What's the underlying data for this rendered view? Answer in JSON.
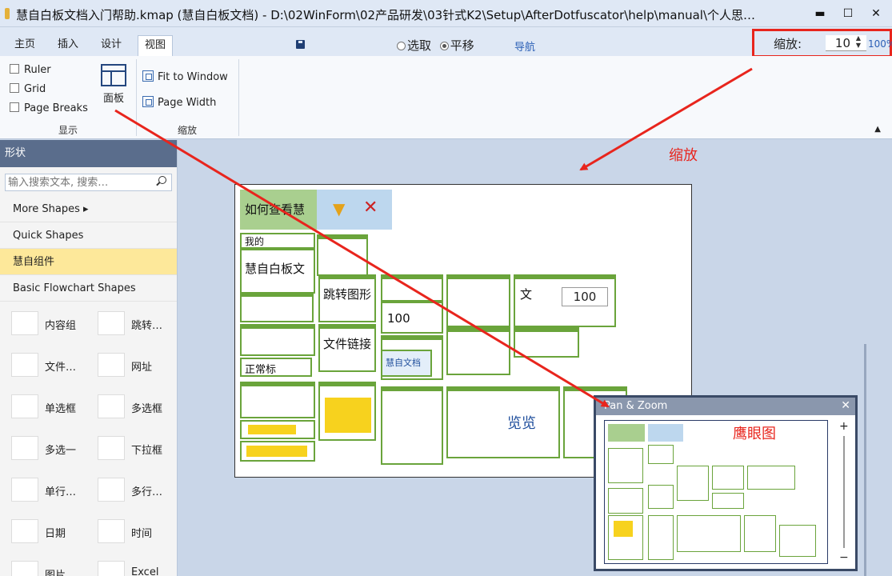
{
  "window": {
    "title": "慧自白板文档入门帮助.kmap (慧自白板文档) -  D:\\02WinForm\\02产品研发\\03针式K2\\Setup\\AfterDotfuscator\\help\\manual\\个人思…",
    "min": "▬",
    "max": "☐",
    "close": "✕"
  },
  "tabs": [
    "主页",
    "插入",
    "设计",
    "视图"
  ],
  "toolbar": {
    "mode_select": "选取",
    "mode_pan": "平移",
    "nav": "导航",
    "zoom_label": "缩放:",
    "zoom_value": "10",
    "zoom_percent": "100%"
  },
  "ribbon": {
    "show_group": {
      "label": "显示",
      "ruler": "Ruler",
      "grid": "Grid",
      "page_breaks": "Page Breaks",
      "panel": "面板"
    },
    "zoom_group": {
      "label": "缩放",
      "fit_window": "Fit to Window",
      "page_width": "Page Width"
    }
  },
  "side": {
    "title": "形状",
    "search_placeholder": "输入搜索文本, 搜索…",
    "categories": [
      "More Shapes ▸",
      "Quick Shapes",
      "慧自组件",
      "Basic Flowchart Shapes"
    ],
    "items": [
      "内容组",
      "跳转…",
      "文件…",
      "网址",
      "单选框",
      "多选框",
      "多选一",
      "下拉框",
      "单行…",
      "多行…",
      "日期",
      "时间",
      "图片",
      "Excel"
    ]
  },
  "annotations": {
    "zoom": "缩放",
    "eagle_eye": "鹰眼图"
  },
  "canvas": {
    "node_how_to": "如何查看慧",
    "node_intro": "慧自白板文",
    "node_jump": "跳转图形",
    "node_file": "文件链接",
    "node_wo": "我的",
    "node_zhengque": "正常标",
    "node_value": "100",
    "node_value2": "100",
    "node_wen": "文",
    "node_huizi": "慧自文档",
    "node_browse": "览览"
  },
  "panzoom": {
    "title": "Pan & Zoom",
    "close": "✕",
    "plus": "+",
    "minus": "−"
  },
  "colors": {
    "accent_red": "#e8251d",
    "node_green": "#6aa43b",
    "highlight_yellow": "#fde89a"
  }
}
